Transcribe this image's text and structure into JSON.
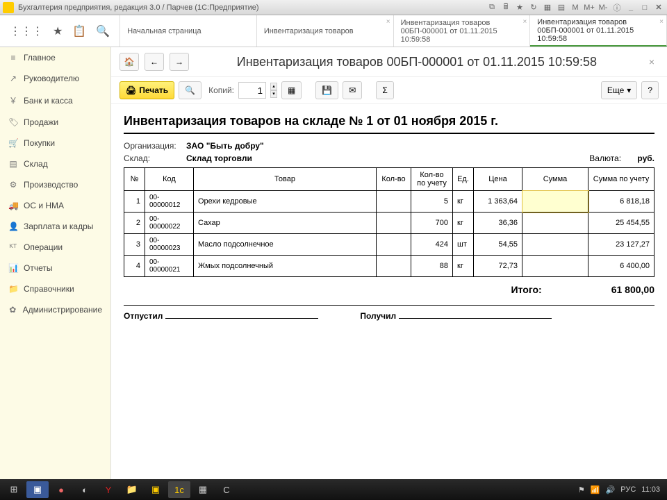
{
  "titlebar": {
    "title": "Бухгалтерия предприятия, редакция 3.0 / Парчев  (1С:Предприятие)",
    "m_buttons": [
      "M",
      "M+",
      "M-"
    ]
  },
  "tabs": [
    {
      "label": "Начальная страница"
    },
    {
      "label": "Инвентаризация товаров"
    },
    {
      "label": "Инвентаризация товаров 00БП-000001 от 01.11.2015 10:59:58"
    },
    {
      "label": "Инвентаризация товаров 00БП-000001 от 01.11.2015 10:59:58"
    }
  ],
  "sidebar": {
    "items": [
      {
        "icon": "≡",
        "label": "Главное"
      },
      {
        "icon": "↗",
        "label": "Руководителю"
      },
      {
        "icon": "￥",
        "label": "Банк и касса"
      },
      {
        "icon": "🏷",
        "label": "Продажи"
      },
      {
        "icon": "🛒",
        "label": "Покупки"
      },
      {
        "icon": "▤",
        "label": "Склад"
      },
      {
        "icon": "⚙",
        "label": "Производство"
      },
      {
        "icon": "🚚",
        "label": "ОС и НМА"
      },
      {
        "icon": "👤",
        "label": "Зарплата и кадры"
      },
      {
        "icon": "ᴷᵀ",
        "label": "Операции"
      },
      {
        "icon": "📊",
        "label": "Отчеты"
      },
      {
        "icon": "📁",
        "label": "Справочники"
      },
      {
        "icon": "✿",
        "label": "Администрирование"
      }
    ]
  },
  "doc": {
    "title": "Инвентаризация товаров 00БП-000001 от 01.11.2015 10:59:58",
    "paper_title": "Инвентаризация товаров на складе № 1 от 01 ноября 2015 г.",
    "org_label": "Организация:",
    "org_value": "ЗАО \"Быть добру\"",
    "wh_label": "Склад:",
    "wh_value": "Склад торговли",
    "currency_label": "Валюта:",
    "currency_value": "руб.",
    "headers": {
      "n": "№",
      "code": "Код",
      "item": "Товар",
      "qty": "Кол-во",
      "qty_acc": "Кол-во по учету",
      "unit": "Ед.",
      "price": "Цена",
      "sum": "Сумма",
      "sum_acc": "Сумма по учету"
    },
    "rows": [
      {
        "n": "1",
        "code": "00-00000012",
        "item": "Орехи кедровые",
        "qty": "",
        "qty_acc": "5",
        "unit": "кг",
        "price": "1 363,64",
        "sum": "",
        "sum_acc": "6 818,18"
      },
      {
        "n": "2",
        "code": "00-00000022",
        "item": "Сахар",
        "qty": "",
        "qty_acc": "700",
        "unit": "кг",
        "price": "36,36",
        "sum": "",
        "sum_acc": "25 454,55"
      },
      {
        "n": "3",
        "code": "00-00000023",
        "item": "Масло подсолнечное",
        "qty": "",
        "qty_acc": "424",
        "unit": "шт",
        "price": "54,55",
        "sum": "",
        "sum_acc": "23 127,27"
      },
      {
        "n": "4",
        "code": "00-00000021",
        "item": "Жмых подсолнечный",
        "qty": "",
        "qty_acc": "88",
        "unit": "кг",
        "price": "72,73",
        "sum": "",
        "sum_acc": "6 400,00"
      }
    ],
    "total_label": "Итого:",
    "total_value": "61 800,00",
    "sign_out": "Отпустил",
    "sign_in": "Получил"
  },
  "actions": {
    "print": "Печать",
    "copies_label": "Копий:",
    "copies_value": "1",
    "more": "Еще",
    "help": "?"
  },
  "taskbar": {
    "lang": "РУС",
    "time": "11:03"
  }
}
